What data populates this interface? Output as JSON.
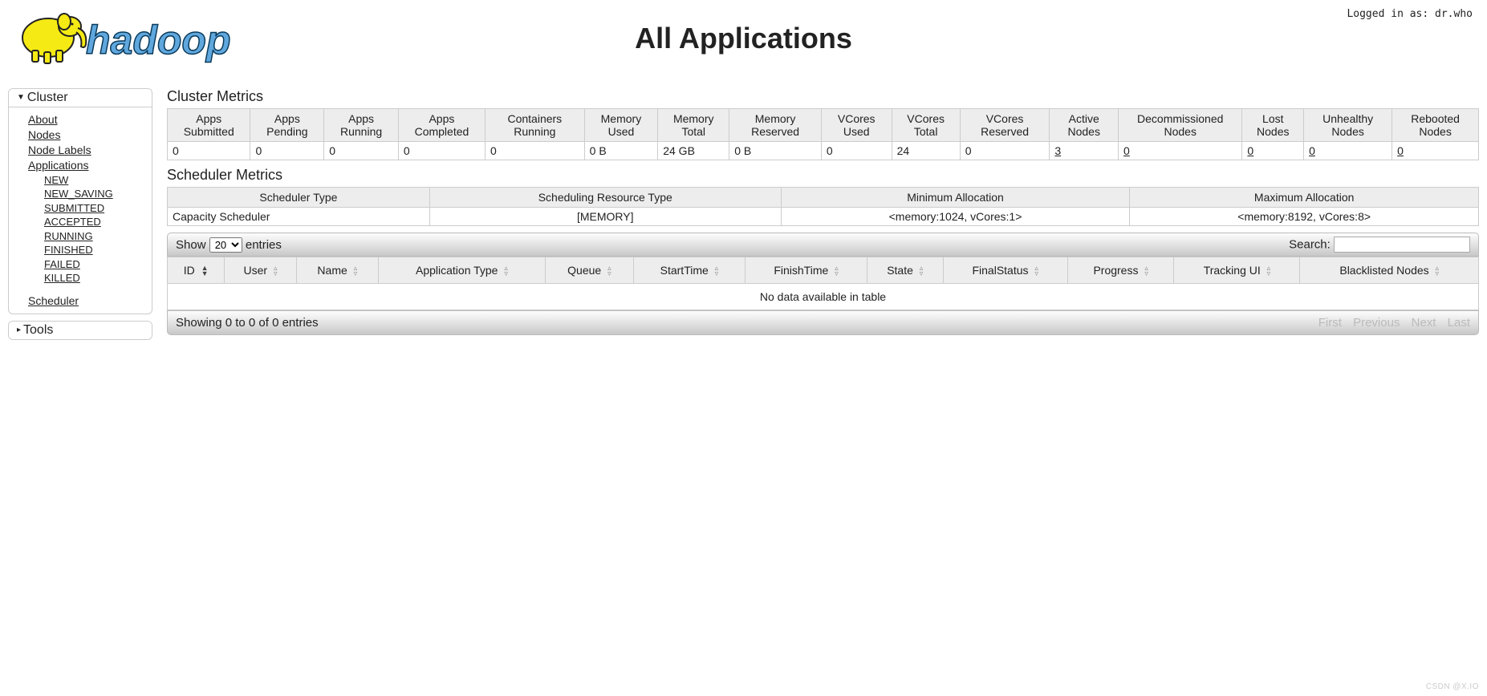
{
  "header": {
    "page_title": "All Applications",
    "logged_in_label": "Logged in as: ",
    "logged_in_user": "dr.who"
  },
  "sidebar": {
    "cluster_label": "Cluster",
    "tools_label": "Tools",
    "links": {
      "about": "About",
      "nodes": "Nodes",
      "node_labels": "Node Labels",
      "applications": "Applications",
      "scheduler": "Scheduler"
    },
    "app_states": [
      "NEW",
      "NEW_SAVING",
      "SUBMITTED",
      "ACCEPTED",
      "RUNNING",
      "FINISHED",
      "FAILED",
      "KILLED"
    ]
  },
  "cluster_metrics": {
    "title": "Cluster Metrics",
    "headers": [
      "Apps Submitted",
      "Apps Pending",
      "Apps Running",
      "Apps Completed",
      "Containers Running",
      "Memory Used",
      "Memory Total",
      "Memory Reserved",
      "VCores Used",
      "VCores Total",
      "VCores Reserved",
      "Active Nodes",
      "Decommissioned Nodes",
      "Lost Nodes",
      "Unhealthy Nodes",
      "Rebooted Nodes"
    ],
    "values": [
      "0",
      "0",
      "0",
      "0",
      "0",
      "0 B",
      "24 GB",
      "0 B",
      "0",
      "24",
      "0",
      "3",
      "0",
      "0",
      "0",
      "0"
    ],
    "link_cols": [
      11,
      12,
      13,
      14,
      15
    ]
  },
  "scheduler_metrics": {
    "title": "Scheduler Metrics",
    "headers": [
      "Scheduler Type",
      "Scheduling Resource Type",
      "Minimum Allocation",
      "Maximum Allocation"
    ],
    "values": [
      "Capacity Scheduler",
      "[MEMORY]",
      "<memory:1024, vCores:1>",
      "<memory:8192, vCores:8>"
    ]
  },
  "datatable": {
    "show_label_pre": "Show ",
    "show_label_post": " entries",
    "page_size": "20",
    "search_label": "Search:",
    "headers": [
      "ID",
      "User",
      "Name",
      "Application Type",
      "Queue",
      "StartTime",
      "FinishTime",
      "State",
      "FinalStatus",
      "Progress",
      "Tracking UI",
      "Blacklisted Nodes"
    ],
    "no_data": "No data available in table",
    "info": "Showing 0 to 0 of 0 entries",
    "pager": [
      "First",
      "Previous",
      "Next",
      "Last"
    ]
  },
  "watermark": "CSDN @X.IO"
}
